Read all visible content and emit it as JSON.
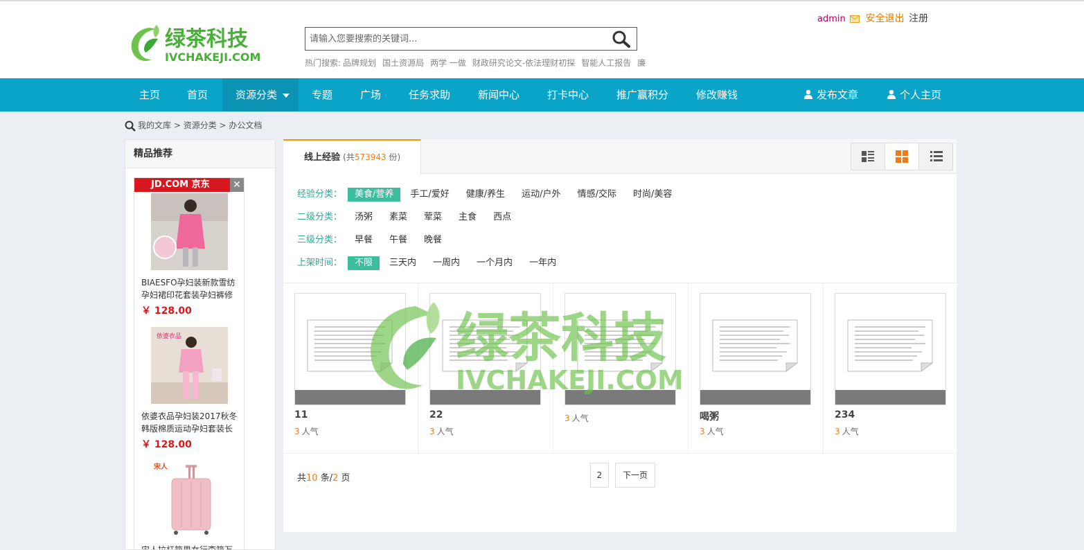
{
  "header": {
    "search_placeholder": "请输入您要搜索的关键词...",
    "hot_label": "热门搜索:",
    "hot_terms": [
      "品牌规划",
      "国土资源局",
      "两学 一做",
      "财政研究论文-依法理财初探",
      "智能人工报告",
      "廉"
    ],
    "user": {
      "name": "admin",
      "logout": "安全退出",
      "register": "注册"
    },
    "logo_cn": "绿茶科技",
    "logo_en": "IVCHAKEJI.COM"
  },
  "nav": {
    "items": [
      {
        "label": "主页"
      },
      {
        "label": "首页"
      },
      {
        "label": "资源分类"
      },
      {
        "label": "专题"
      },
      {
        "label": "广场"
      },
      {
        "label": "任务求助"
      },
      {
        "label": "新闻中心"
      },
      {
        "label": "打卡中心"
      },
      {
        "label": "推广赢积分"
      },
      {
        "label": "修改赚钱"
      }
    ],
    "publish": "发布文章",
    "profile": "个人主页"
  },
  "breadcrumb": [
    "我的文库",
    "资源分类",
    "办公文档"
  ],
  "sidebar": {
    "title": "精品推荐",
    "ad_brand": "JD.COM 京东",
    "products": [
      {
        "name": "BIAESFO孕妇装新款雪纺孕妇裙印花套装孕妇裤修",
        "price": "￥ 128.00"
      },
      {
        "name": "依婆衣品孕妇装2017秋冬韩版棉质运动孕妇套装长",
        "price": "￥ 128.00",
        "logo": "依婆衣品"
      },
      {
        "name": "宋人拉杆箱男女行李箱万",
        "logo": "宋人"
      }
    ]
  },
  "main": {
    "tab": {
      "label": "线上经验",
      "prefix": "(共",
      "count": "573943",
      "suffix": " 份)"
    },
    "filters": [
      {
        "label": "经验分类：",
        "options": [
          "美食/营养",
          "手工/爱好",
          "健康/养生",
          "运动/户外",
          "情感/交际",
          "时尚/美容"
        ],
        "active": 0
      },
      {
        "label": "二级分类：",
        "options": [
          "汤粥",
          "素菜",
          "荤菜",
          "主食",
          "西点"
        ],
        "active": -1
      },
      {
        "label": "三级分类：",
        "options": [
          "早餐",
          "午餐",
          "晚餐"
        ],
        "active": -1
      },
      {
        "label": "上架时间：",
        "options": [
          "不限",
          "三天内",
          "一周内",
          "一个月内",
          "一年内"
        ],
        "active": 0
      }
    ],
    "cards": [
      {
        "title": "11",
        "pop": "3",
        "pop_unit": "人气"
      },
      {
        "title": "22",
        "pop": "3",
        "pop_unit": "人气"
      },
      {
        "title": "",
        "pop": "3",
        "pop_unit": "人气"
      },
      {
        "title": "喝粥",
        "pop": "3",
        "pop_unit": "人气"
      },
      {
        "title": "234",
        "pop": "3",
        "pop_unit": "人气"
      }
    ],
    "pager": {
      "t1": "共",
      "total": "10",
      "t2": " 条/",
      "pages": "2",
      "t3": " 页",
      "page_btn": "2",
      "next": "下一页"
    }
  },
  "colors": {
    "nav": "#0aa4c8",
    "accent": "#3bbd9e",
    "orange": "#e67e22",
    "price": "#d7181f"
  }
}
